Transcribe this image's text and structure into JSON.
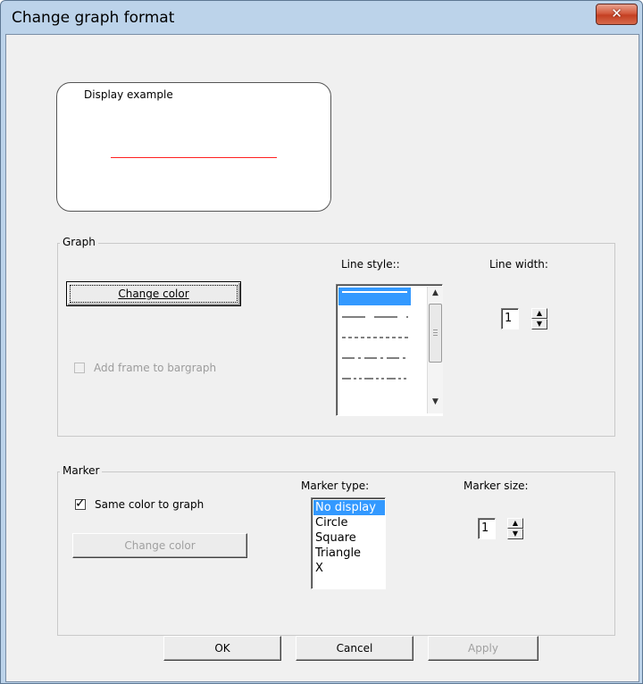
{
  "window": {
    "title": "Change graph format"
  },
  "preview": {
    "label": "Display example",
    "line_color": "#ff2020"
  },
  "graph": {
    "group_label": "Graph",
    "change_color_label": "Change color",
    "frame_checkbox_label": "Add frame to bargraph",
    "frame_checkbox_checked": false,
    "line_style_label": "Line style::",
    "line_width_label": "Line width:",
    "line_width_value": "1",
    "line_styles": [
      "solid",
      "long-dash",
      "short-dash",
      "dash-dot",
      "dash-dot-dot"
    ],
    "selected_line_style": "solid"
  },
  "marker": {
    "group_label": "Marker",
    "same_color_label": "Same color to graph",
    "same_color_checked": true,
    "change_color_label": "Change color",
    "type_label": "Marker type:",
    "types": [
      "No display",
      "Circle",
      "Square",
      "Triangle",
      "X"
    ],
    "selected_type": "No display",
    "size_label": "Marker size:",
    "size_value": "1"
  },
  "footer": {
    "ok_label": "OK",
    "cancel_label": "Cancel",
    "apply_label": "Apply"
  },
  "colors": {
    "titlebar": "#bcd3ea",
    "close_button": "#c94a2e",
    "selection": "#3399ff"
  }
}
